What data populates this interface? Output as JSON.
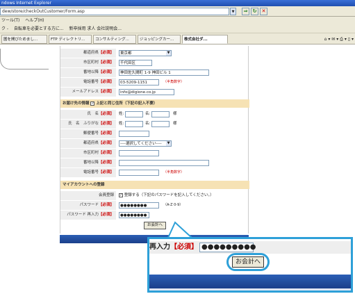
{
  "browser": {
    "title": "ndows Internet Explorer",
    "address": "dew/store/checkOutCustomer/Form.asp",
    "menu": [
      "ツール(T)",
      "ヘルプ(H)"
    ],
    "links": [
      "ク -",
      "自転車を必要とする方に...",
      "新卒採用 求人 会社説明会..."
    ],
    "tabs": [
      "圖を開びためまし...",
      "FTP ディレクトリ...",
      "コンサルティング...",
      "ジョッピングカー...",
      "株式会社ダ..."
    ]
  },
  "form": {
    "rows": [
      {
        "label": "都道府県",
        "req": "【必須】",
        "value": "東京都"
      },
      {
        "label": "市区町村",
        "req": "【必須】",
        "value": "千代田区"
      },
      {
        "label": "番地以降",
        "req": "【必須】",
        "value": "神田佐久間町 1-9 神田ビル 1"
      },
      {
        "label": "電話番号",
        "req": "【必須】",
        "value": "03-5209-1151",
        "note": "（半角数字）"
      },
      {
        "label": "メールアドレス",
        "req": "【必須】",
        "value": "info@digione.co.jp"
      }
    ],
    "delivery_head": "お届け先の情報",
    "delivery_checkbox": "上記と同じ住所（下記の記入不要）",
    "delivery_rows": [
      {
        "label": "氏　名",
        "req": "【必須】",
        "sei": "姓:",
        "mei": "名:",
        "sama": "様"
      },
      {
        "label": "氏　名　ふりがな",
        "req": "【必須】",
        "sei": "姓:",
        "mei": "名:",
        "sama": "様"
      },
      {
        "label": "郵便番号",
        "req": "【必須】"
      },
      {
        "label": "都道府県",
        "req": "【必須】",
        "value": "----選択してください----"
      },
      {
        "label": "市区町村",
        "req": "【必須】"
      },
      {
        "label": "番地以降",
        "req": "【必須】"
      },
      {
        "label": "電話番号",
        "req": "【必須】",
        "note": "（半角数字）"
      }
    ],
    "account_head": "マイアカウントへの登録",
    "account_rows": [
      {
        "label": "会員登録",
        "checkbox": "登録する（下記のパスワードを記入してください。）"
      },
      {
        "label": "パスワード",
        "req": "【必須】",
        "value": "●●●●●●●●",
        "note": "（A-Z 0-9）"
      },
      {
        "label": "パスワード 再入力",
        "req": "【必須】",
        "value": "●●●●●●●●"
      }
    ],
    "submit": "お会計へ"
  },
  "zoom": {
    "label": "再入力",
    "req": "【必須】",
    "password": "●●●●●●●●●",
    "submit": "お会計へ"
  }
}
